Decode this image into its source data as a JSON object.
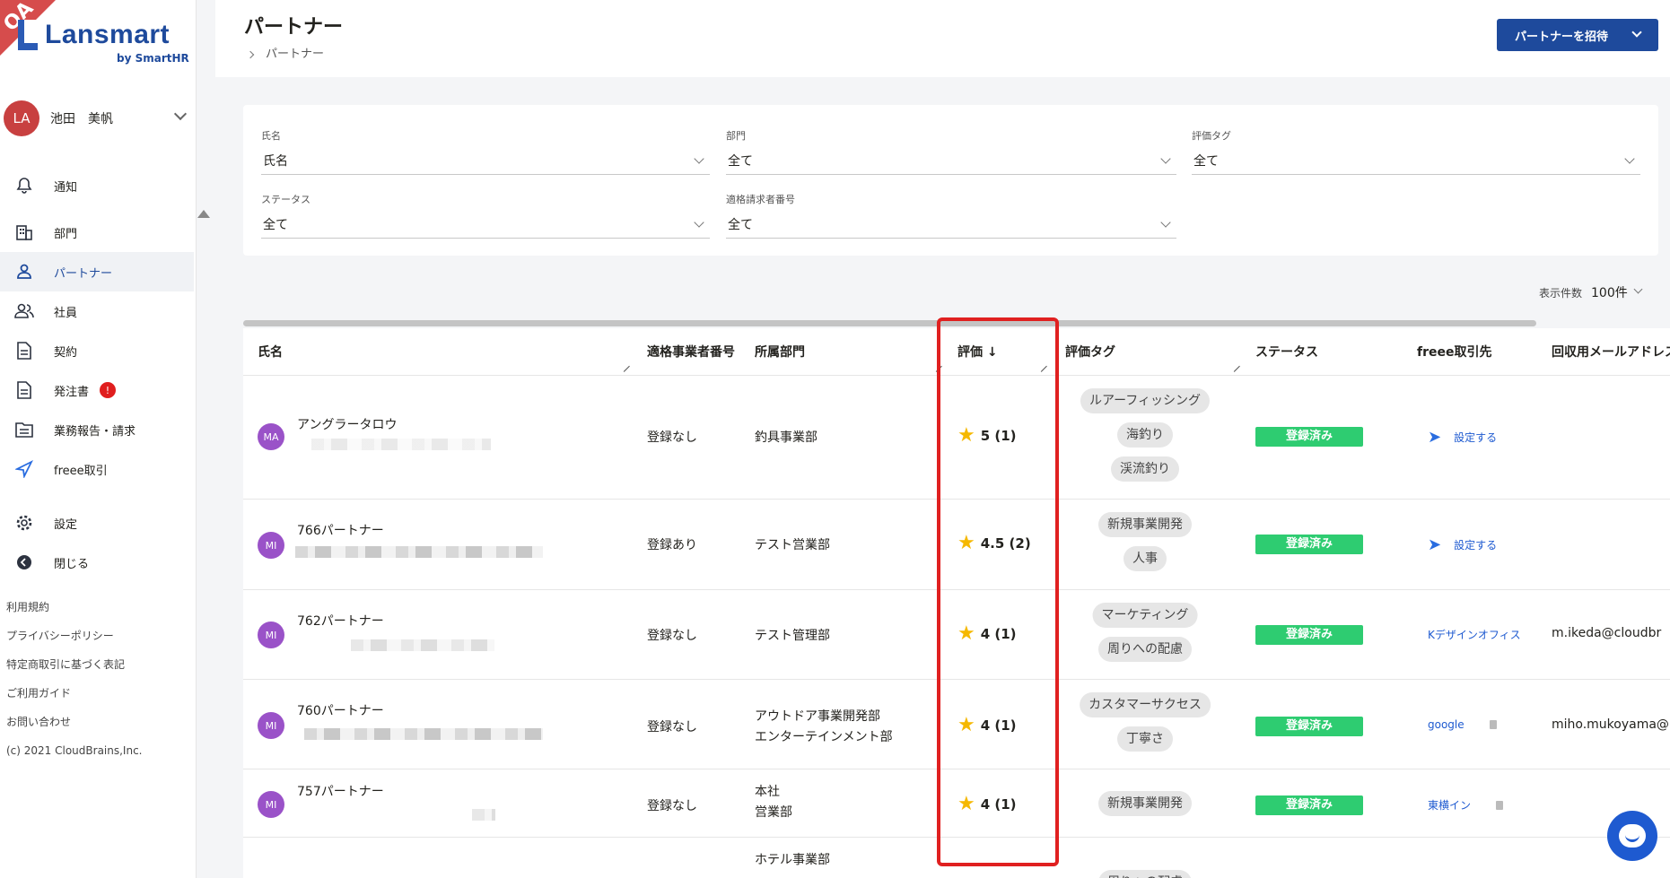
{
  "logo": {
    "text": "Lansmart",
    "sub": "by SmartHR",
    "corner": "QA"
  },
  "user": {
    "initials": "LA",
    "name": "池田　美帆"
  },
  "nav": [
    {
      "label": "通知",
      "icon": "bell-icon"
    },
    {
      "label": "部門",
      "icon": "building-icon"
    },
    {
      "label": "パートナー",
      "icon": "person-icon",
      "active": true
    },
    {
      "label": "社員",
      "icon": "people-icon"
    },
    {
      "label": "契約",
      "icon": "document-icon"
    },
    {
      "label": "発注書",
      "icon": "document-icon",
      "badge": "!"
    },
    {
      "label": "業務報告・請求",
      "icon": "folder-icon"
    },
    {
      "label": "freee取引",
      "icon": "freee-icon"
    },
    {
      "label": "設定",
      "icon": "gear-icon"
    },
    {
      "label": "閉じる",
      "icon": "arrow-left-icon"
    }
  ],
  "footer_links": [
    "利用規約",
    "プライバシーポリシー",
    "特定商取引に基づく表記",
    "ご利用ガイド",
    "お問い合わせ",
    "(c) 2021 CloudBrains,Inc."
  ],
  "header": {
    "title": "パートナー",
    "breadcrumb": "パートナー",
    "invite_label": "パートナーを招待"
  },
  "filters": {
    "name": {
      "label": "氏名",
      "value": "氏名"
    },
    "department": {
      "label": "部門",
      "value": "全て"
    },
    "eval_tag": {
      "label": "評価タグ",
      "value": "全て"
    },
    "status": {
      "label": "ステータス",
      "value": "全て"
    },
    "invoice_no": {
      "label": "適格請求者番号",
      "value": "全て"
    }
  },
  "per_page": {
    "label": "表示件数",
    "value": "100件"
  },
  "columns": {
    "name": "氏名",
    "invoice": "適格事業者番号",
    "dept": "所属部門",
    "rating": "評価 ↓",
    "tags": "評価タグ",
    "status": "ステータス",
    "freee": "freee取引先",
    "email": "回収用メールアドレス"
  },
  "rows": [
    {
      "initials": "MA",
      "name": "アングラータロウ",
      "invoice": "登録なし",
      "dept": [
        "釣具事業部"
      ],
      "rating": "5 (1)",
      "tags": [
        "ルアーフィッシング",
        "海釣り",
        "渓流釣り"
      ],
      "status": "登録済み",
      "freee": "設定する",
      "email": ""
    },
    {
      "initials": "MI",
      "name": "766パートナー",
      "invoice": "登録あり",
      "dept": [
        "テスト営業部"
      ],
      "rating": "4.5 (2)",
      "tags": [
        "新規事業開発",
        "人事"
      ],
      "status": "登録済み",
      "freee": "設定する",
      "email": ""
    },
    {
      "initials": "MI",
      "name": "762パートナー",
      "invoice": "登録なし",
      "dept": [
        "テスト管理部"
      ],
      "rating": "4 (1)",
      "tags": [
        "マーケティング",
        "周りへの配慮"
      ],
      "status": "登録済み",
      "freee": "Kデザインオフィス",
      "email": "m.ikeda@cloudbr"
    },
    {
      "initials": "MI",
      "name": "760パートナー",
      "invoice": "登録なし",
      "dept": [
        "アウトドア事業開発部",
        "エンターテインメント部"
      ],
      "rating": "4 (1)",
      "tags": [
        "カスタマーサクセス",
        "丁寧さ"
      ],
      "status": "登録済み",
      "freee": "google",
      "email": "miho.mukoyama@"
    },
    {
      "initials": "MI",
      "name": "757パートナー",
      "invoice": "登録なし",
      "dept": [
        "本社",
        "営業部"
      ],
      "rating": "4 (1)",
      "tags": [
        "新規事業開発"
      ],
      "status": "登録済み",
      "freee": "東横イン",
      "email": ""
    },
    {
      "initials": "",
      "name": "",
      "invoice": "",
      "dept": [
        "ホテル事業部"
      ],
      "rating": "",
      "tags": [
        "周りへの配慮"
      ],
      "status": "",
      "freee": "",
      "email": ""
    }
  ]
}
